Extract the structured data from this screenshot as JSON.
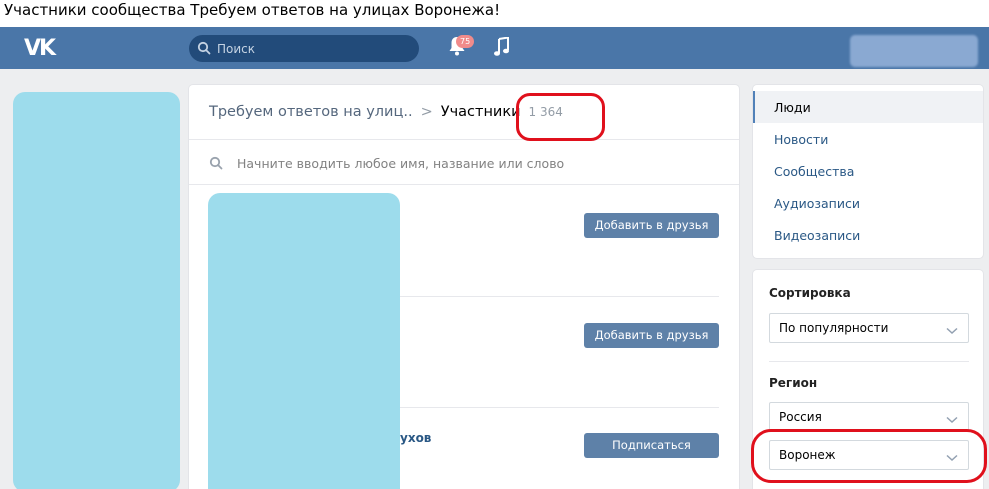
{
  "window": {
    "title": "Участники сообщества Требуем ответов на улицах Воронежа!"
  },
  "header": {
    "logo_text": "VK",
    "search_placeholder": "Поиск",
    "notifications_count": "75",
    "icons": [
      "search-icon",
      "bell-icon",
      "music-icon"
    ],
    "brand_color": "#4a76a8"
  },
  "breadcrumb": {
    "group": "Требуем ответов на улиц..",
    "separator": ">",
    "current": "Участники",
    "count": "1 364"
  },
  "member_search": {
    "placeholder": "Начните вводить любое имя, название или слово"
  },
  "members": [
    {
      "name": "",
      "action": "Добавить в друзья"
    },
    {
      "name": "",
      "action": "Добавить в друзья"
    },
    {
      "name": "ухов",
      "action": "Подписаться"
    }
  ],
  "sidebar_menu": {
    "items": [
      {
        "label": "Люди",
        "active": true
      },
      {
        "label": "Новости",
        "active": false
      },
      {
        "label": "Сообщества",
        "active": false
      },
      {
        "label": "Аудиозаписи",
        "active": false
      },
      {
        "label": "Видеозаписи",
        "active": false
      }
    ]
  },
  "filters": {
    "sort_title": "Сортировка",
    "sort_value": "По популярности",
    "region_title": "Регион",
    "country_value": "Россия",
    "city_value": "Воронеж"
  },
  "colors": {
    "button": "#5e81a8",
    "link": "#2a5885",
    "annotation": "#e0101c"
  }
}
